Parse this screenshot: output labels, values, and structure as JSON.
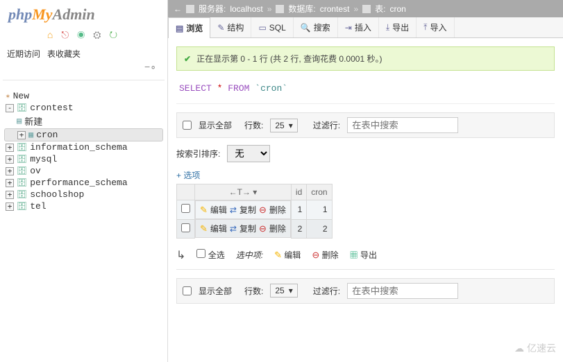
{
  "logo": {
    "php": "php",
    "my": "My",
    "admin": "Admin"
  },
  "visited": {
    "recent": "近期访问",
    "fav": "表收藏夹"
  },
  "tree": {
    "new": "New",
    "crontest": "crontest",
    "newtbl": "新建",
    "cron": "cron",
    "information_schema": "information_schema",
    "mysql": "mysql",
    "ov": "ov",
    "performance_schema": "performance_schema",
    "schoolshop": "schoolshop",
    "tel": "tel"
  },
  "bc": {
    "server_lbl": "服务器:",
    "server": "localhost",
    "db_lbl": "数据库:",
    "db": "crontest",
    "tbl_lbl": "表:",
    "tbl": "cron"
  },
  "tabs": {
    "browse": "浏览",
    "struct": "结构",
    "sql": "SQL",
    "search": "搜索",
    "insert": "插入",
    "export": "导出",
    "import": "导入"
  },
  "msg": "正在显示第 0 - 1 行 (共 2 行, 查询花费 0.0001 秒。)",
  "sql": {
    "select": "SELECT",
    "star": "*",
    "from": "FROM",
    "table": "`cron`"
  },
  "filter": {
    "showall": "显示全部",
    "rows_lbl": "行数:",
    "rows_val": "25",
    "filter_lbl": "过滤行:",
    "placeholder": "在表中搜索"
  },
  "order": {
    "lbl": "按索引排序:",
    "val": "无"
  },
  "opts": "+ 选项",
  "thead": {
    "arrows": "←T→",
    "id": "id",
    "cron": "cron"
  },
  "rowact": {
    "edit": "编辑",
    "copy": "复制",
    "del": "删除"
  },
  "rows": [
    {
      "id": "1",
      "cron": "1"
    },
    {
      "id": "2",
      "cron": "2"
    }
  ],
  "bulk": {
    "selall": "全选",
    "sel_lbl": "选中项:",
    "edit": "编辑",
    "del": "删除",
    "export": "导出"
  },
  "watermark": "亿速云"
}
